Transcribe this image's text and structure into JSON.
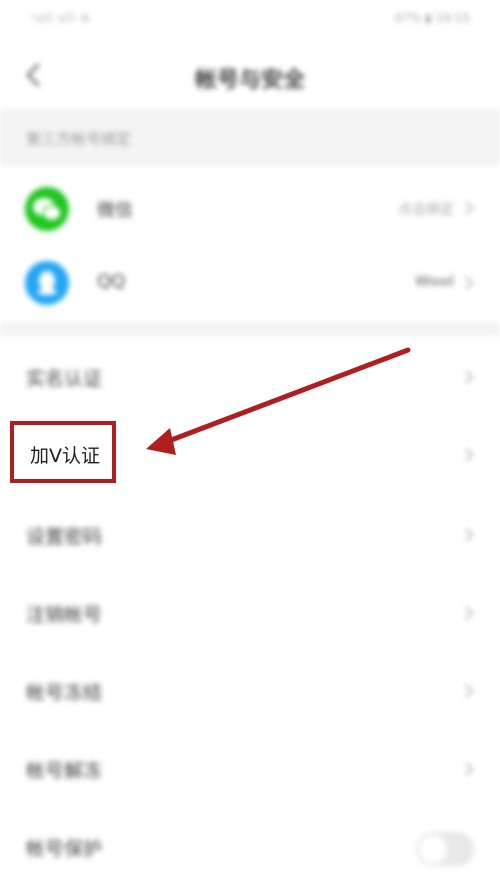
{
  "status_bar": {
    "left": "¹ull ull ≋",
    "right": "47% ▮ 19:15"
  },
  "header": {
    "title": "帐号与安全"
  },
  "third_party": {
    "section_title": "第三方帐号绑定",
    "items": [
      {
        "label": "微信",
        "value": "点击绑定",
        "color": "#1fc51f"
      },
      {
        "label": "QQ",
        "value": "Wool",
        "color": "#22a6f2"
      }
    ]
  },
  "list": {
    "items": [
      {
        "label": "实名认证"
      },
      {
        "label": "加V认证"
      },
      {
        "label": "设置密码"
      },
      {
        "label": "注销帐号"
      },
      {
        "label": "帐号冻结"
      },
      {
        "label": "帐号解冻"
      },
      {
        "label": "帐号保护"
      }
    ]
  },
  "annotation": {
    "box_color": "#b01f1f",
    "arrow_color": "#b01f1f"
  }
}
